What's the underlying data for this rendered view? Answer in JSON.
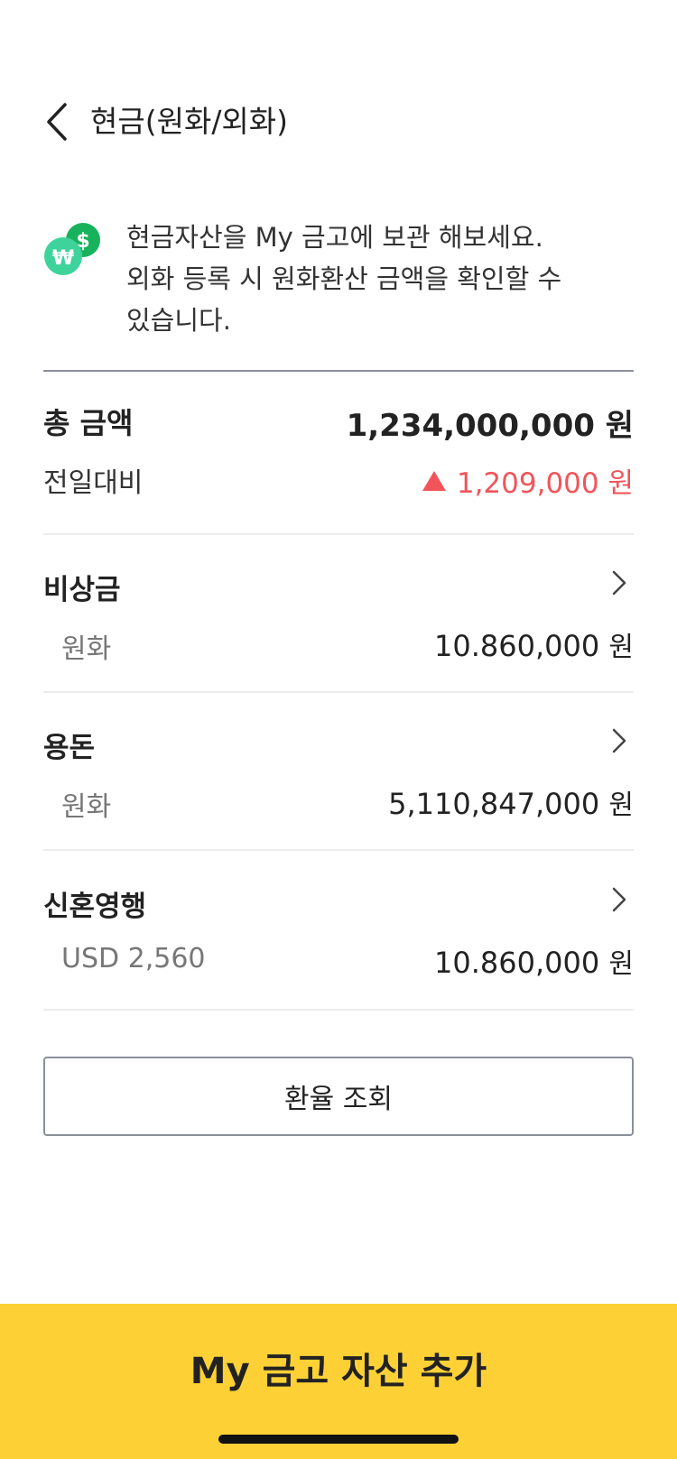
{
  "header": {
    "title": "현금(원화/외화)"
  },
  "intro": {
    "text_line1": "현금자산을 My 금고에 보관 해보세요.",
    "text_line2": "외화 등록 시 원화환산 금액을 확인할 수",
    "text_line3": "있습니다.",
    "icon_colors": {
      "back_coin": "#19b25c",
      "front_coin": "#3fd39c"
    }
  },
  "summary": {
    "total_label": "총 금액",
    "total_amount": "1,234,000,000 원",
    "diff_label": "전일대비",
    "diff_amount": "1,209,000 원",
    "diff_color": "#f2545b"
  },
  "assets": [
    {
      "name": "비상금",
      "sub": "원화",
      "amount": "10.860,000",
      "unit": "원"
    },
    {
      "name": "용돈",
      "sub": "원화",
      "amount": "5,110,847,000",
      "unit": "원"
    },
    {
      "name": "신혼영행",
      "sub": "USD 2,560",
      "amount": "10.860,000",
      "unit": "원"
    }
  ],
  "actions": {
    "exchange_rate_label": "환율 조회",
    "add_asset_label": "My 금고 자산 추가"
  },
  "colors": {
    "accent_yellow": "#fdd136",
    "positive_red": "#f2545b"
  }
}
